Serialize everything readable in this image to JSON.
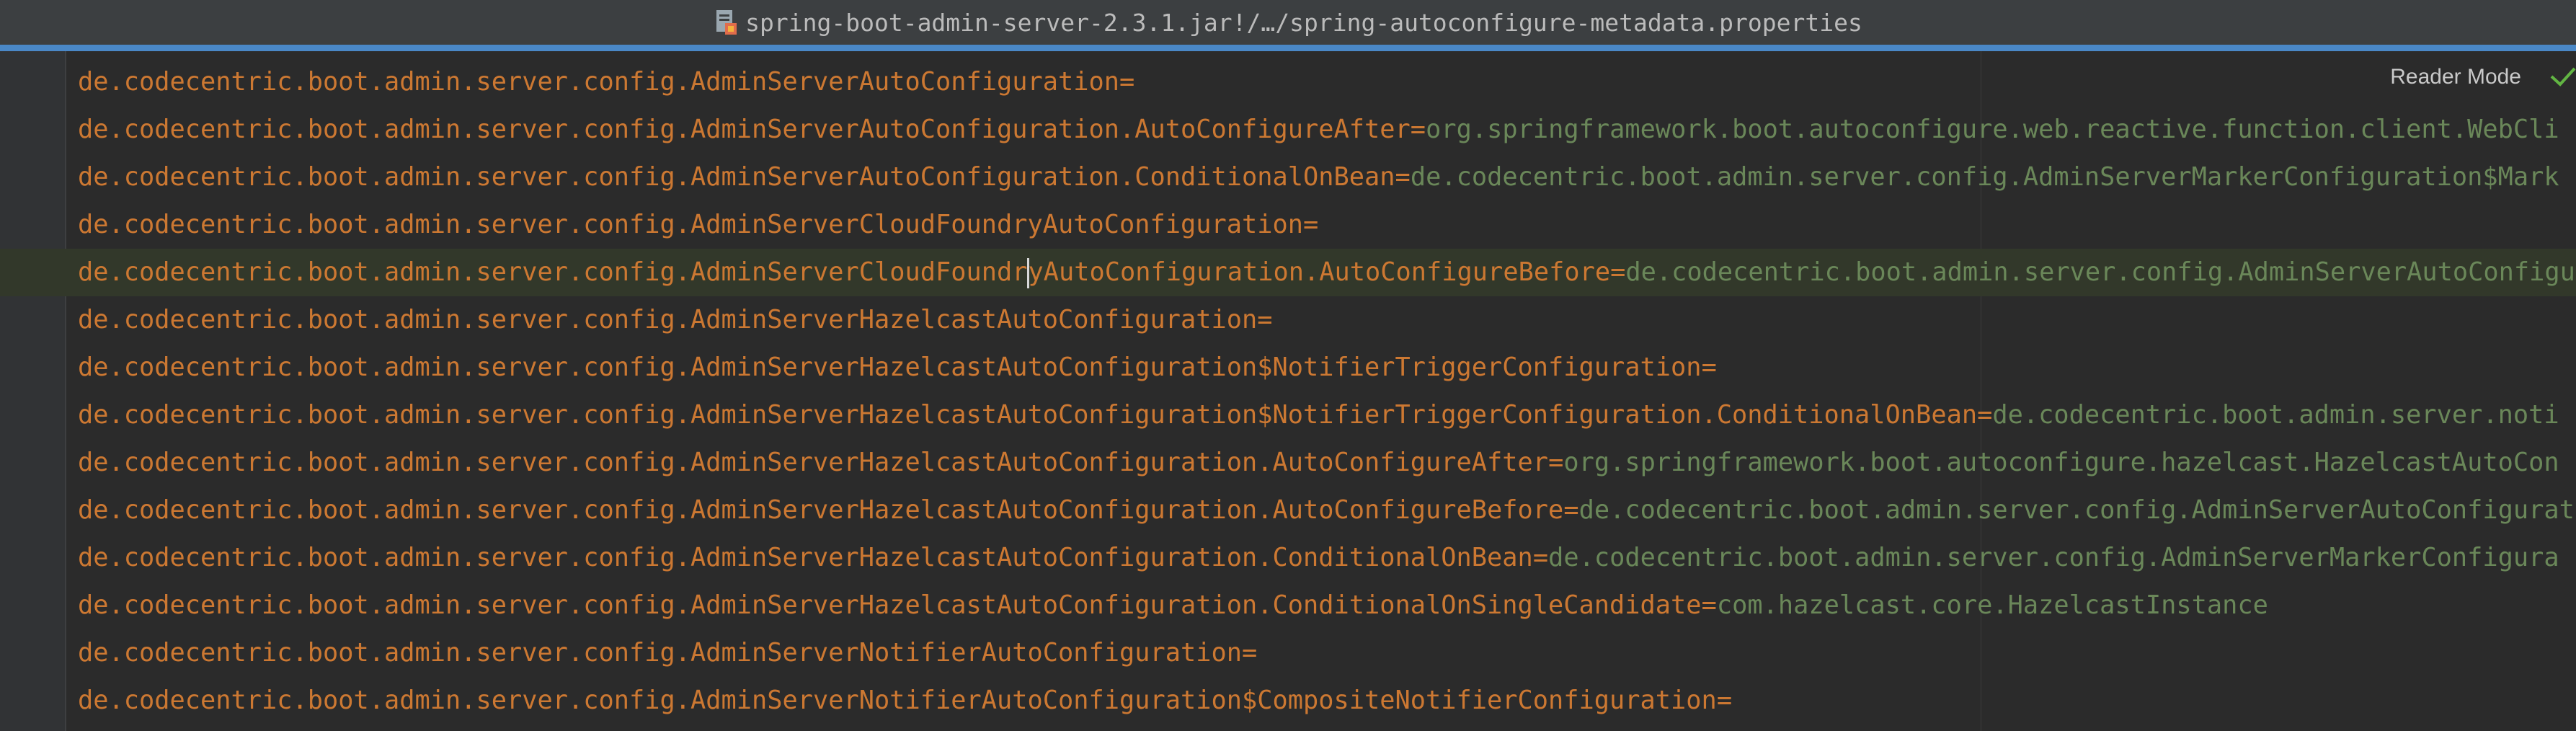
{
  "window": {
    "title": "spring-boot-admin-server-2.3.1.jar!/…/spring-autoconfigure-metadata.properties",
    "file_icon": "properties-file-icon"
  },
  "editor": {
    "reader_mode_label": "Reader Mode",
    "lines": [
      {
        "key": "de.codecentric.boot.admin.server.config.AdminServerAutoConfiguration",
        "eq": "=",
        "value": ""
      },
      {
        "key": "de.codecentric.boot.admin.server.config.AdminServerAutoConfiguration.AutoConfigureAfter",
        "eq": "=",
        "value": "org.springframework.boot.autoconfigure.web.reactive.function.client.WebCli"
      },
      {
        "key": "de.codecentric.boot.admin.server.config.AdminServerAutoConfiguration.ConditionalOnBean",
        "eq": "=",
        "value": "de.codecentric.boot.admin.server.config.AdminServerMarkerConfiguration$Mark"
      },
      {
        "key": "de.codecentric.boot.admin.server.config.AdminServerCloudFoundryAutoConfiguration",
        "eq": "=",
        "value": ""
      },
      {
        "key_a": "de.codecentric.boot.admin.server.config.AdminServerCloudFoundr",
        "key_b": "yAutoConfiguration.AutoConfigureBefore",
        "eq": "=",
        "value": "de.codecentric.boot.admin.server.config.AdminServerAutoConfigu"
      },
      {
        "key": "de.codecentric.boot.admin.server.config.AdminServerHazelcastAutoConfiguration",
        "eq": "=",
        "value": ""
      },
      {
        "key": "de.codecentric.boot.admin.server.config.AdminServerHazelcastAutoConfiguration$NotifierTriggerConfiguration",
        "eq": "=",
        "value": ""
      },
      {
        "key": "de.codecentric.boot.admin.server.config.AdminServerHazelcastAutoConfiguration$NotifierTriggerConfiguration.ConditionalOnBean",
        "eq": "=",
        "value": "de.codecentric.boot.admin.server.noti"
      },
      {
        "key": "de.codecentric.boot.admin.server.config.AdminServerHazelcastAutoConfiguration.AutoConfigureAfter",
        "eq": "=",
        "value": "org.springframework.boot.autoconfigure.hazelcast.HazelcastAutoCon"
      },
      {
        "key": "de.codecentric.boot.admin.server.config.AdminServerHazelcastAutoConfiguration.AutoConfigureBefore",
        "eq": "=",
        "value": "de.codecentric.boot.admin.server.config.AdminServerAutoConfigurat"
      },
      {
        "key": "de.codecentric.boot.admin.server.config.AdminServerHazelcastAutoConfiguration.ConditionalOnBean",
        "eq": "=",
        "value": "de.codecentric.boot.admin.server.config.AdminServerMarkerConfigura"
      },
      {
        "key": "de.codecentric.boot.admin.server.config.AdminServerHazelcastAutoConfiguration.ConditionalOnSingleCandidate",
        "eq": "=",
        "value": "com.hazelcast.core.HazelcastInstance"
      },
      {
        "key": "de.codecentric.boot.admin.server.config.AdminServerNotifierAutoConfiguration",
        "eq": "=",
        "value": ""
      },
      {
        "key": "de.codecentric.boot.admin.server.config.AdminServerNotifierAutoConfiguration$CompositeNotifierConfiguration",
        "eq": "=",
        "value": ""
      }
    ]
  },
  "colors": {
    "key": "#cc7832",
    "value": "#6a8759",
    "background": "#2b2b2b",
    "current_line": "#32382a",
    "accent": "#4a88c7"
  }
}
